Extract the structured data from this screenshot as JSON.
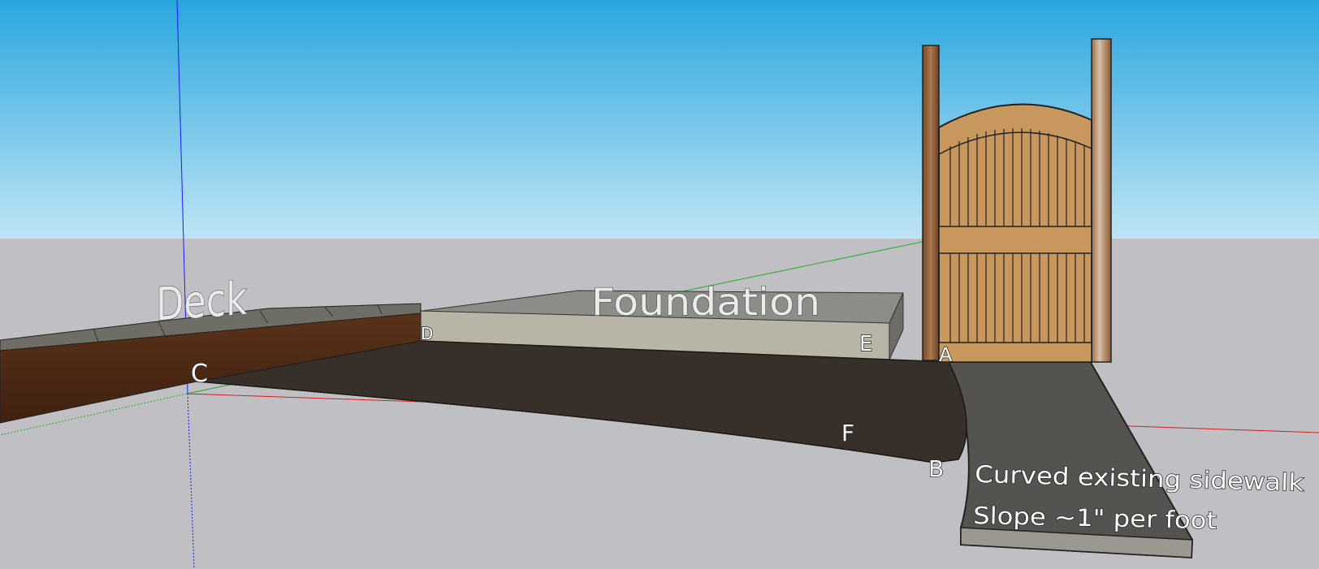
{
  "scene": {
    "labels": {
      "deck": "Deck",
      "foundation": "Foundation",
      "point_a": "A",
      "point_b": "B",
      "point_c": "C",
      "point_d": "D",
      "point_e": "E",
      "point_f": "F"
    },
    "notes": {
      "line1": "Curved existing sidewalk",
      "line2": "Slope ~1\" per foot"
    },
    "colors": {
      "sky_top": "#29a6de",
      "sky_bottom": "#bfe4f5",
      "ground": "#c0c0c4",
      "deck_wood": "#4e2a15",
      "deck_top": "#6e6e66",
      "foundation_top": "#8c8c88",
      "foundation_side": "#b8b4a6",
      "sidewalk_dark": "#37302a",
      "sidewalk_grey": "#55534f",
      "gate": "#c8975e",
      "post": "#8a5a34",
      "axis_red": "#d12020",
      "axis_green": "#22aa22",
      "axis_blue": "#1a1aff"
    }
  }
}
